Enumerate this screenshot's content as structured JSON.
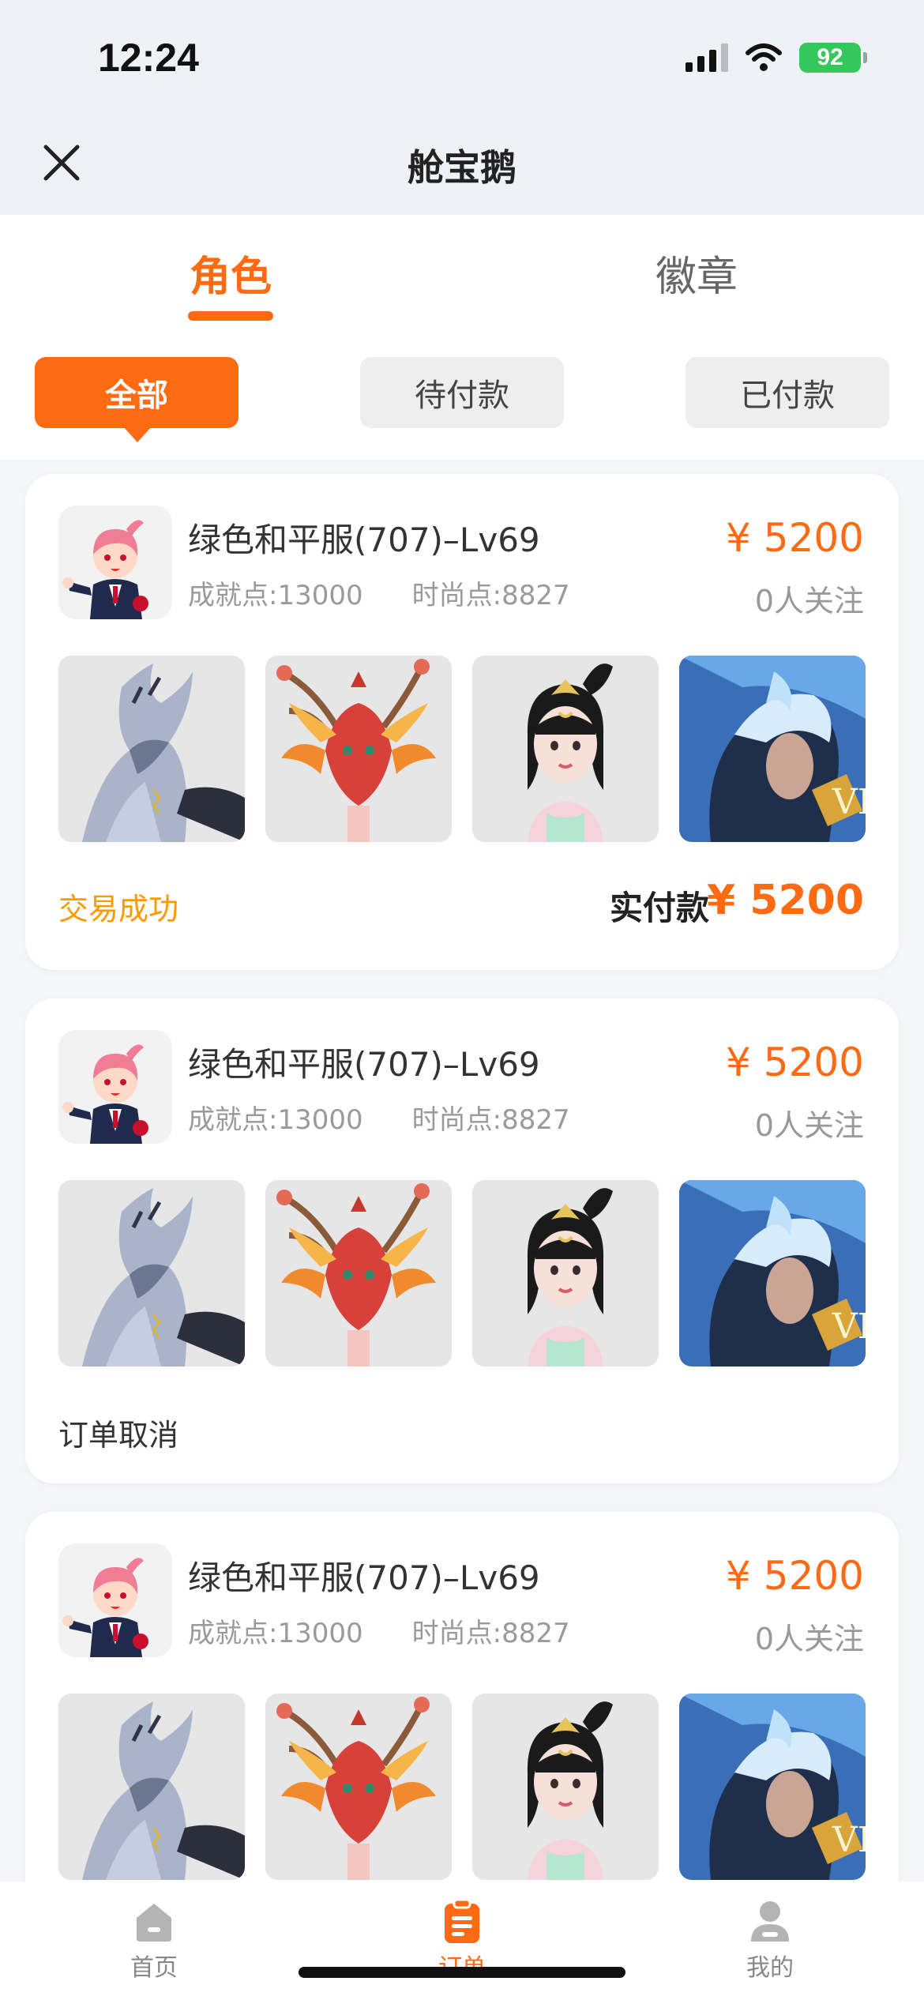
{
  "status_bar": {
    "time": "12:24",
    "battery": "92"
  },
  "header": {
    "title": "舱宝鹅"
  },
  "tabs": [
    {
      "label": "角色",
      "active": true
    },
    {
      "label": "徽章",
      "active": false
    }
  ],
  "filters": [
    {
      "label": "全部",
      "active": true
    },
    {
      "label": "待付款",
      "active": false
    },
    {
      "label": "已付款",
      "active": false
    }
  ],
  "orders": [
    {
      "title": "绿色和平服(707)–Lv69",
      "achievement": "成就点:13000",
      "fashion": "时尚点:8827",
      "price": "¥ 5200",
      "watchers": "0人关注",
      "status": "交易成功",
      "paid_label": "实付款",
      "paid_value": "¥ 5200"
    },
    {
      "title": "绿色和平服(707)–Lv69",
      "achievement": "成就点:13000",
      "fashion": "时尚点:8827",
      "price": "¥ 5200",
      "watchers": "0人关注",
      "status": "订单取消"
    },
    {
      "title": "绿色和平服(707)–Lv69",
      "achievement": "成就点:13000",
      "fashion": "时尚点:8827",
      "price": "¥ 5200",
      "watchers": "0人关注"
    }
  ],
  "bottom_nav": [
    {
      "label": "首页",
      "icon": "home-icon",
      "active": false
    },
    {
      "label": "订单",
      "icon": "order-clipboard-icon",
      "active": true
    },
    {
      "label": "我的",
      "icon": "person-icon",
      "active": false
    }
  ],
  "colors": {
    "accent": "#ff6a13",
    "success": "#ff9900"
  }
}
